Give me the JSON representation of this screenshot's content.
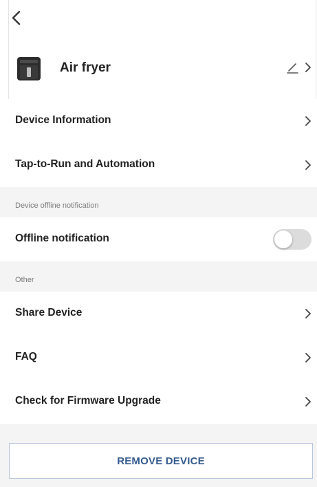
{
  "device": {
    "name": "Air fryer"
  },
  "rows": {
    "device_information": "Device Information",
    "tap_to_run": "Tap-to-Run and Automation",
    "offline_notification": "Offline notification",
    "share_device": "Share Device",
    "faq": "FAQ",
    "firmware_upgrade": "Check for Firmware Upgrade"
  },
  "sections": {
    "device_offline": "Device offline notification",
    "other": "Other"
  },
  "toggle": {
    "offline_notification_on": false
  },
  "buttons": {
    "remove_device": "REMOVE DEVICE"
  },
  "icons": {
    "back": "back-chevron-icon",
    "device": "air-fryer-icon",
    "edit": "pencil-icon",
    "chevron": "chevron-right-icon"
  },
  "colors": {
    "accent": "#345a8e",
    "section_bg": "#f4f4f4",
    "toggle_off": "#dcdcdc"
  }
}
